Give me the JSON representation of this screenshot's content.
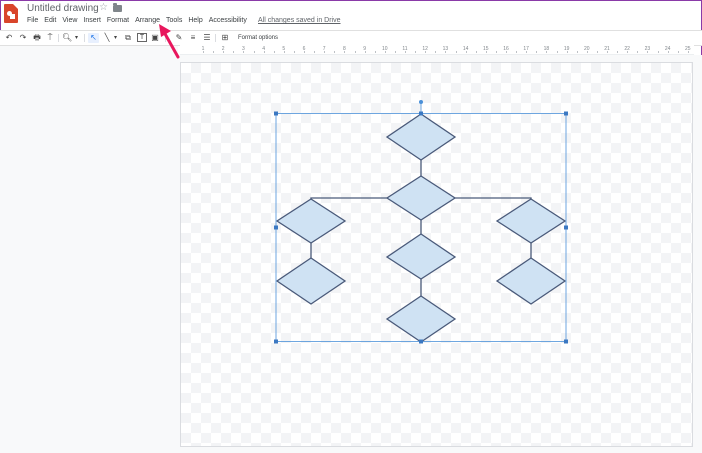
{
  "header": {
    "title": "Untitled drawing",
    "star_icon": "star-outline-icon",
    "folder_icon": "folder-icon",
    "saved_status": "All changes saved in Drive"
  },
  "menu": [
    "File",
    "Edit",
    "View",
    "Insert",
    "Format",
    "Arrange",
    "Tools",
    "Help",
    "Accessibility"
  ],
  "toolbar": {
    "undo": "↶",
    "redo": "↷",
    "print": "🖶",
    "paint_format": "⍑",
    "zoom": "🔍︎",
    "zoom_caret": "▾",
    "select": "↖",
    "line": "╲",
    "line_caret": "▾",
    "shape": "⧉",
    "textbox": "T",
    "image": "▣",
    "line_color": "✎",
    "line_weight": "≡",
    "line_dash": "☰",
    "comment": "⊞",
    "format_options": "Format options"
  },
  "ruler": {
    "labels": [
      "1",
      "2",
      "3",
      "4",
      "5",
      "6",
      "7",
      "8",
      "9",
      "10",
      "11",
      "12",
      "13",
      "14",
      "15",
      "16",
      "17",
      "18",
      "19",
      "20",
      "21",
      "22",
      "23",
      "24",
      "25"
    ]
  },
  "colors": {
    "accent": "#e8175d",
    "selection": "#4a90d9",
    "shape_fill": "#cfe2f3",
    "shape_stroke": "#4a5a7a",
    "connector": "#4a5a7a"
  }
}
